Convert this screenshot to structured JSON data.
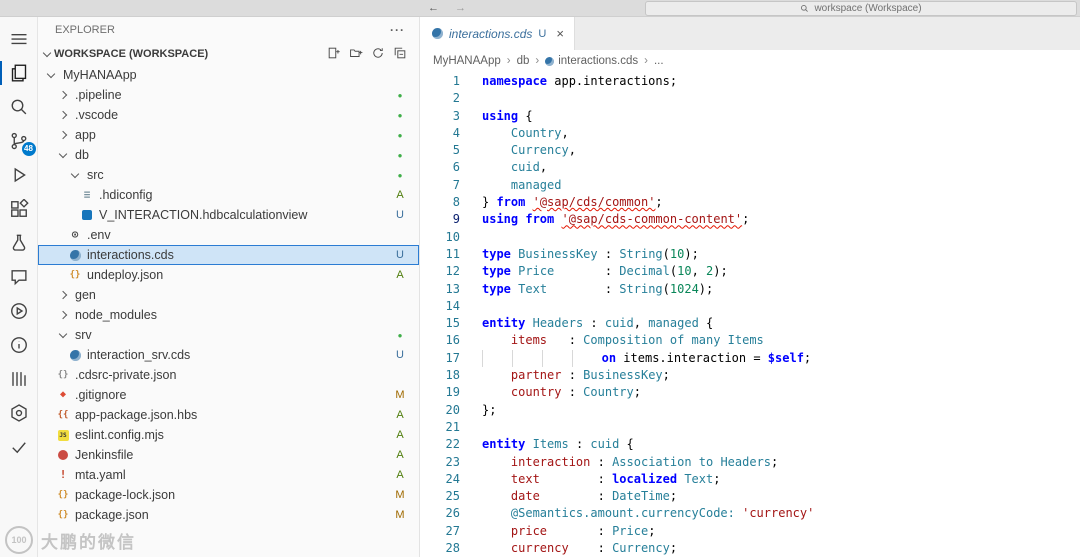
{
  "titlebar": {
    "back": "←",
    "forward": "→",
    "command_center": "workspace (Workspace)"
  },
  "activity_bar": {
    "items": [
      {
        "icon": "menu"
      },
      {
        "icon": "explorer",
        "active": true
      },
      {
        "icon": "search"
      },
      {
        "icon": "source-control",
        "badge": "48"
      },
      {
        "icon": "run-debug"
      },
      {
        "icon": "extensions"
      },
      {
        "icon": "test"
      },
      {
        "icon": "chat"
      },
      {
        "icon": "run"
      },
      {
        "icon": "info"
      },
      {
        "icon": "output"
      },
      {
        "icon": "settings"
      },
      {
        "icon": "check"
      }
    ]
  },
  "sidebar": {
    "title": "EXPLORER",
    "more_glyph": "···",
    "section": {
      "label": "WORKSPACE (WORKSPACE)",
      "actions": [
        "new-file",
        "new-folder",
        "refresh",
        "collapse-all"
      ]
    },
    "tree": [
      {
        "label": "MyHANAApp",
        "level": 1,
        "kind": "folder",
        "expanded": true
      },
      {
        "label": ".pipeline",
        "level": 2,
        "kind": "folder",
        "dot": true
      },
      {
        "label": ".vscode",
        "level": 2,
        "kind": "folder",
        "dot": true
      },
      {
        "label": "app",
        "level": 2,
        "kind": "folder",
        "dot": true
      },
      {
        "label": "db",
        "level": 2,
        "kind": "folder",
        "expanded": true,
        "dot": true
      },
      {
        "label": "src",
        "level": 3,
        "kind": "folder",
        "expanded": true,
        "dot": true
      },
      {
        "label": ".hdiconfig",
        "level": 4,
        "kind": "file",
        "icon": "config",
        "badge": "A"
      },
      {
        "label": "V_INTERACTION.hdbcalculationview",
        "level": 4,
        "kind": "file",
        "icon": "calcview",
        "badge": "U"
      },
      {
        "label": ".env",
        "level": 3,
        "kind": "file",
        "icon": "gear"
      },
      {
        "label": "interactions.cds",
        "level": 3,
        "kind": "file",
        "icon": "cds",
        "badge": "U",
        "selected": true
      },
      {
        "label": "undeploy.json",
        "level": 3,
        "kind": "file",
        "icon": "json",
        "badge": "A"
      },
      {
        "label": "gen",
        "level": 2,
        "kind": "folder"
      },
      {
        "label": "node_modules",
        "level": 2,
        "kind": "folder"
      },
      {
        "label": "srv",
        "level": 2,
        "kind": "folder",
        "expanded": true,
        "dot": true
      },
      {
        "label": "interaction_srv.cds",
        "level": 3,
        "kind": "file",
        "icon": "cds",
        "badge": "U"
      },
      {
        "label": ".cdsrc-private.json",
        "level": 2,
        "kind": "file",
        "icon": "json-gray"
      },
      {
        "label": ".gitignore",
        "level": 2,
        "kind": "file",
        "icon": "git",
        "badge": "M"
      },
      {
        "label": "app-package.json.hbs",
        "level": 2,
        "kind": "file",
        "icon": "hbs",
        "badge": "A"
      },
      {
        "label": "eslint.config.mjs",
        "level": 2,
        "kind": "file",
        "icon": "js",
        "badge": "A"
      },
      {
        "label": "Jenkinsfile",
        "level": 2,
        "kind": "file",
        "icon": "jenkins",
        "badge": "A"
      },
      {
        "label": "mta.yaml",
        "level": 2,
        "kind": "file",
        "icon": "yaml",
        "badge": "A"
      },
      {
        "label": "package-lock.json",
        "level": 2,
        "kind": "file",
        "icon": "json",
        "badge": "M"
      },
      {
        "label": "package.json",
        "level": 2,
        "kind": "file",
        "icon": "json",
        "badge": "M"
      }
    ]
  },
  "editor": {
    "tabs": [
      {
        "label": "interactions.cds",
        "status": "U",
        "icon": "cds",
        "close": "×",
        "active": true
      }
    ],
    "breadcrumb_sep": "›",
    "breadcrumb": [
      {
        "label": "MyHANAApp"
      },
      {
        "label": "db"
      },
      {
        "label": "interactions.cds",
        "icon": "cds"
      },
      {
        "label": "..."
      }
    ],
    "code": {
      "active_line": 9,
      "lines": [
        {
          "n": 1,
          "t": [
            [
              "k",
              "namespace"
            ],
            [
              "pl",
              " app.interactions;"
            ]
          ]
        },
        {
          "n": 2,
          "t": []
        },
        {
          "n": 3,
          "t": [
            [
              "k",
              "using"
            ],
            [
              "pl",
              " {"
            ]
          ]
        },
        {
          "n": 4,
          "t": [
            [
              "pl",
              "    "
            ],
            [
              "t",
              "Country"
            ],
            [
              "pl",
              ","
            ]
          ]
        },
        {
          "n": 5,
          "t": [
            [
              "pl",
              "    "
            ],
            [
              "t",
              "Currency"
            ],
            [
              "pl",
              ","
            ]
          ]
        },
        {
          "n": 6,
          "t": [
            [
              "pl",
              "    "
            ],
            [
              "t",
              "cuid"
            ],
            [
              "pl",
              ","
            ]
          ]
        },
        {
          "n": 7,
          "t": [
            [
              "pl",
              "    "
            ],
            [
              "t",
              "managed"
            ]
          ]
        },
        {
          "n": 8,
          "t": [
            [
              "pl",
              "} "
            ],
            [
              "k",
              "from"
            ],
            [
              "pl",
              " "
            ],
            [
              "e",
              "'@sap/cds/common'"
            ],
            [
              "pl",
              ";"
            ]
          ]
        },
        {
          "n": 9,
          "t": [
            [
              "k",
              "using"
            ],
            [
              "pl",
              " "
            ],
            [
              "k",
              "from"
            ],
            [
              "pl",
              " "
            ],
            [
              "e",
              "'@sap/cds-common-content'"
            ],
            [
              "pl",
              ";"
            ]
          ]
        },
        {
          "n": 10,
          "t": []
        },
        {
          "n": 11,
          "t": [
            [
              "k",
              "type"
            ],
            [
              "pl",
              " "
            ],
            [
              "t",
              "BusinessKey"
            ],
            [
              "pl",
              " : "
            ],
            [
              "t",
              "String"
            ],
            [
              "pl",
              "("
            ],
            [
              "n",
              "10"
            ],
            [
              "pl",
              ");"
            ]
          ]
        },
        {
          "n": 12,
          "t": [
            [
              "k",
              "type"
            ],
            [
              "pl",
              " "
            ],
            [
              "t",
              "Price"
            ],
            [
              "pl",
              "       : "
            ],
            [
              "t",
              "Decimal"
            ],
            [
              "pl",
              "("
            ],
            [
              "n",
              "10"
            ],
            [
              "pl",
              ", "
            ],
            [
              "n",
              "2"
            ],
            [
              "pl",
              ");"
            ]
          ]
        },
        {
          "n": 13,
          "t": [
            [
              "k",
              "type"
            ],
            [
              "pl",
              " "
            ],
            [
              "t",
              "Text"
            ],
            [
              "pl",
              "        : "
            ],
            [
              "t",
              "String"
            ],
            [
              "pl",
              "("
            ],
            [
              "n",
              "1024"
            ],
            [
              "pl",
              ");"
            ]
          ]
        },
        {
          "n": 14,
          "t": []
        },
        {
          "n": 15,
          "t": [
            [
              "k",
              "entity"
            ],
            [
              "pl",
              " "
            ],
            [
              "t",
              "Headers"
            ],
            [
              "pl",
              " : "
            ],
            [
              "t",
              "cuid"
            ],
            [
              "pl",
              ", "
            ],
            [
              "t",
              "managed"
            ],
            [
              "pl",
              " {"
            ]
          ]
        },
        {
          "n": 16,
          "t": [
            [
              "pl",
              "    "
            ],
            [
              "p",
              "items"
            ],
            [
              "pl",
              "   : "
            ],
            [
              "t",
              "Composition of many Items"
            ]
          ]
        },
        {
          "n": 17,
          "t": [
            [
              "g",
              "    "
            ],
            [
              "g",
              "    "
            ],
            [
              "g",
              "    "
            ],
            [
              "g",
              "    "
            ],
            [
              "k",
              "on"
            ],
            [
              "pl",
              " items.interaction = "
            ],
            [
              "k",
              "$self"
            ],
            [
              "pl",
              ";"
            ]
          ]
        },
        {
          "n": 18,
          "t": [
            [
              "pl",
              "    "
            ],
            [
              "p",
              "partner"
            ],
            [
              "pl",
              " : "
            ],
            [
              "t",
              "BusinessKey"
            ],
            [
              "pl",
              ";"
            ]
          ]
        },
        {
          "n": 19,
          "t": [
            [
              "pl",
              "    "
            ],
            [
              "p",
              "country"
            ],
            [
              "pl",
              " : "
            ],
            [
              "t",
              "Country"
            ],
            [
              "pl",
              ";"
            ]
          ]
        },
        {
          "n": 20,
          "t": [
            [
              "pl",
              "};"
            ]
          ]
        },
        {
          "n": 21,
          "t": []
        },
        {
          "n": 22,
          "t": [
            [
              "k",
              "entity"
            ],
            [
              "pl",
              " "
            ],
            [
              "t",
              "Items"
            ],
            [
              "pl",
              " : "
            ],
            [
              "t",
              "cuid"
            ],
            [
              "pl",
              " {"
            ]
          ]
        },
        {
          "n": 23,
          "t": [
            [
              "pl",
              "    "
            ],
            [
              "p",
              "interaction"
            ],
            [
              "pl",
              " : "
            ],
            [
              "t",
              "Association to Headers"
            ],
            [
              "pl",
              ";"
            ]
          ]
        },
        {
          "n": 24,
          "t": [
            [
              "pl",
              "    "
            ],
            [
              "p",
              "text"
            ],
            [
              "pl",
              "        : "
            ],
            [
              "k",
              "localized"
            ],
            [
              "pl",
              " "
            ],
            [
              "t",
              "Text"
            ],
            [
              "pl",
              ";"
            ]
          ]
        },
        {
          "n": 25,
          "t": [
            [
              "pl",
              "    "
            ],
            [
              "p",
              "date"
            ],
            [
              "pl",
              "        : "
            ],
            [
              "t",
              "DateTime"
            ],
            [
              "pl",
              ";"
            ]
          ]
        },
        {
          "n": 26,
          "t": [
            [
              "pl",
              "    "
            ],
            [
              "a",
              "@Semantics.amount.currencyCode:"
            ],
            [
              "pl",
              " "
            ],
            [
              "s",
              "'currency'"
            ]
          ]
        },
        {
          "n": 27,
          "t": [
            [
              "pl",
              "    "
            ],
            [
              "p",
              "price"
            ],
            [
              "pl",
              "       : "
            ],
            [
              "t",
              "Price"
            ],
            [
              "pl",
              ";"
            ]
          ]
        },
        {
          "n": 28,
          "t": [
            [
              "pl",
              "    "
            ],
            [
              "p",
              "currency"
            ],
            [
              "pl",
              "    : "
            ],
            [
              "t",
              "Currency"
            ],
            [
              "pl",
              ";"
            ]
          ]
        }
      ]
    }
  },
  "watermark": {
    "logo": "100",
    "text": "大鹏的微信"
  }
}
